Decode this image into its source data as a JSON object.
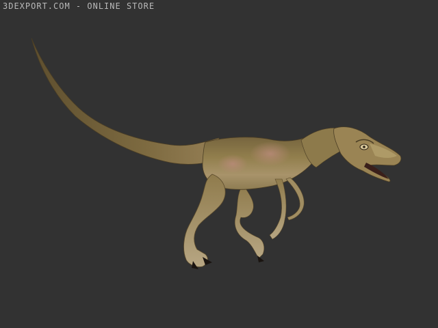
{
  "watermark": {
    "text": "3DEXPORT.COM - ONLINE STORE"
  },
  "scene": {
    "background": "#323232",
    "subject": "raptor-3d-model"
  },
  "colors": {
    "body_base": "#8a7a4a",
    "body_back": "#6b5a38",
    "body_belly": "#b9aa7a",
    "skin_pink": "#b08070",
    "claw": "#1a1410",
    "mouth": "#3a1f1a"
  }
}
